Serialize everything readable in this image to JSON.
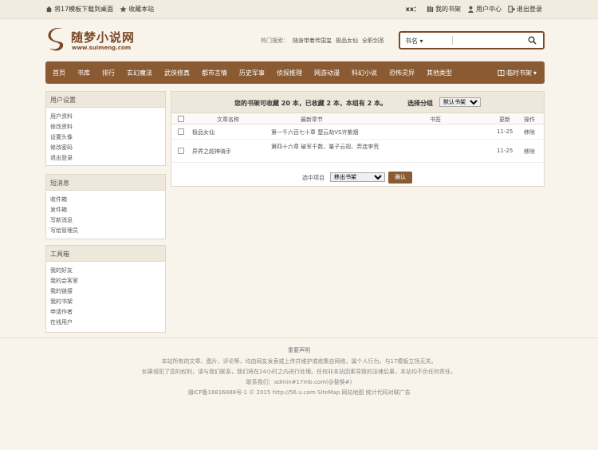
{
  "topbar": {
    "download": "将17模板下载到桌面",
    "favorite": "收藏本站",
    "user": "xx：",
    "my_shelf": "我的书架",
    "user_center": "用户中心",
    "logout": "退出登录"
  },
  "logo": {
    "name": "随梦小说网",
    "url": "www.suimeng.com"
  },
  "hot": {
    "label": "热门搜索：",
    "keywords": [
      "随身带着传国玺",
      "极品女仙",
      "全职剑圣"
    ]
  },
  "search": {
    "category": "书名",
    "value": ""
  },
  "nav": {
    "items": [
      "首页",
      "书库",
      "排行",
      "玄幻魔法",
      "武侠修真",
      "都市言情",
      "历史军事",
      "侦探推理",
      "网游动漫",
      "科幻小说",
      "恐怖灵异",
      "其他类型"
    ],
    "bookshelf": "临时书架"
  },
  "sidebar": {
    "user_settings": {
      "title": "用户设置",
      "items": [
        "用户资料",
        "修改资料",
        "设置头像",
        "修改密码",
        "退出登录"
      ]
    },
    "messages": {
      "title": "短消息",
      "items": [
        "收件箱",
        "发件箱",
        "写新消息",
        "写给管理员"
      ]
    },
    "toolbox": {
      "title": "工具箱",
      "items": [
        "我的好友",
        "我的会客室",
        "我的链接",
        "我的书架",
        "申请作者",
        "在线用户"
      ]
    }
  },
  "shelf": {
    "info": "您的书架可收藏 20 本，已收藏 2 本，本组有 2 本。",
    "group_label": "选择分组",
    "group_value": "默认书架",
    "headers": {
      "name": "文章名称",
      "latest": "最新章节",
      "bookmark": "书签",
      "update": "更新",
      "action": "操作"
    },
    "rows": [
      {
        "name": "极品女仙",
        "latest": "第一千六百七十章 楚云劫VS许紫烟",
        "bookmark": "",
        "update": "11-25",
        "action": "移除"
      },
      {
        "name": "异界之超神骑手",
        "latest": "第四十六章 破军千数、量子云视、弄连李荒",
        "bookmark": "",
        "update": "11-25",
        "action": "移除"
      }
    ],
    "footer_label": "选中项目",
    "footer_select": "移出书架",
    "footer_button": "确认"
  },
  "footer": {
    "heading": "重要声明",
    "lines": [
      "本站所有的文章、图片、评论等，均由网友发表或上传并维护或收集自网络，属个人行为，与17模板立场无关。",
      "如果侵犯了您的权利，请与我们联系，我们将在24小时之内进行处理。任何非本站因素导致的法律后果，本站均不负任何责任。",
      "联系我们：admin#17mb.com(@替换#)",
      "湘ICP备16816888号-1 © 2015 http://56.u.com SiteMap 网站地图 统计代码对联广告"
    ]
  },
  "colors": {
    "brand": "#8a5a32",
    "panel_header": "#eee7db",
    "page_bg": "#f8f4ec"
  }
}
